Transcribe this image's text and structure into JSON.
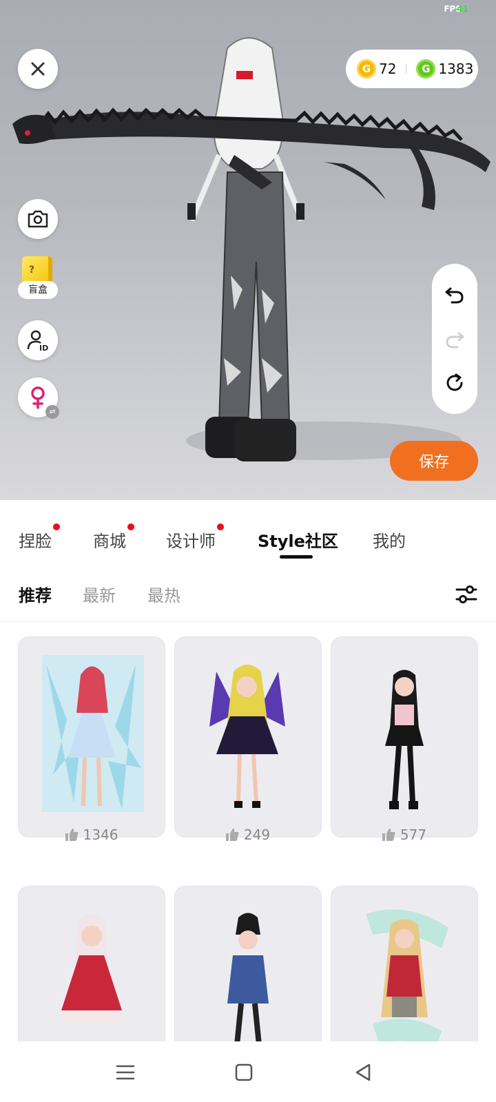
{
  "hud": {
    "fps_label": "FPS",
    "fps_value": "41"
  },
  "currency": {
    "gold_amount": "72",
    "green_amount": "1383",
    "gold_symbol": "G",
    "green_symbol": "G"
  },
  "left_tools": {
    "blindbox_label": "盲盒"
  },
  "save_label": "保存",
  "tabs": [
    {
      "label": "捏脸",
      "has_dot": true
    },
    {
      "label": "商城",
      "has_dot": true
    },
    {
      "label": "设计师",
      "has_dot": true
    },
    {
      "label": "Style社区",
      "has_dot": false,
      "active": true
    },
    {
      "label": "我的",
      "has_dot": false
    }
  ],
  "subtabs": [
    {
      "label": "推荐",
      "active": true
    },
    {
      "label": "最新"
    },
    {
      "label": "最热"
    }
  ],
  "posts": [
    {
      "likes": "1346"
    },
    {
      "likes": "249"
    },
    {
      "likes": "577"
    },
    {
      "likes": ""
    },
    {
      "likes": ""
    },
    {
      "likes": ""
    }
  ],
  "colors": {
    "accent": "#f07020",
    "badge": "#e8101c",
    "gold": "#f5b900",
    "green": "#62c820"
  }
}
